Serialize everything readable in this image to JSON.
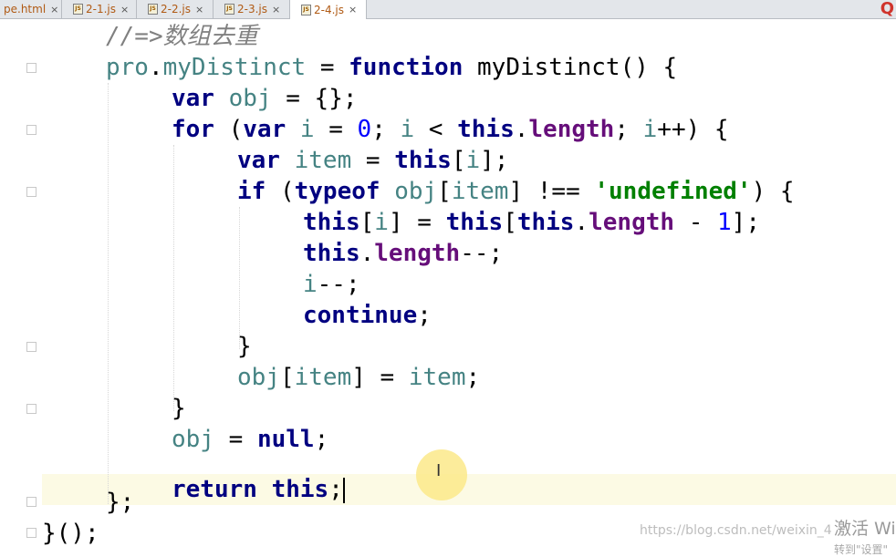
{
  "tabs": [
    {
      "label": "pe.html",
      "icon": "html-file-icon",
      "close": "×",
      "active": false
    },
    {
      "label": "2-1.js",
      "icon_text": "JS",
      "close": "×",
      "active": false
    },
    {
      "label": "2-2.js",
      "icon_text": "JS",
      "close": "×",
      "active": false
    },
    {
      "label": "2-3.js",
      "icon_text": "JS",
      "close": "×",
      "active": false
    },
    {
      "label": "2-4.js",
      "icon_text": "JS",
      "close": "×",
      "active": true
    }
  ],
  "tab_overflow_glyph": "Q",
  "code": {
    "l1": {
      "comment": "//=>数组去重"
    },
    "l2": {
      "a": "pro",
      "b": ".",
      "c": "myDistinct",
      "d": " = ",
      "e": "function",
      "f": " myDistinct",
      "g": "() {"
    },
    "l3": {
      "a": "var",
      "b": " obj",
      "c": " = {};"
    },
    "l4": {
      "a": "for",
      "b": " (",
      "c": "var",
      "d": " i",
      "e": " = ",
      "f": "0",
      "g": "; ",
      "h": "i",
      "i": " < ",
      "j": "this",
      "k": ".",
      "l": "length",
      "m": "; ",
      "n": "i",
      "o": "++) {"
    },
    "l5": {
      "a": "var",
      "b": " item",
      "c": " = ",
      "d": "this",
      "e": "[",
      "f": "i",
      "g": "];"
    },
    "l6": {
      "a": "if",
      "b": " (",
      "c": "typeof",
      "d": " obj",
      "e": "[",
      "f": "item",
      "g": "] !== ",
      "h": "'undefined'",
      "i": ") {"
    },
    "l7": {
      "a": "this",
      "b": "[",
      "c": "i",
      "d": "] = ",
      "e": "this",
      "f": "[",
      "g": "this",
      "h": ".",
      "i": "length",
      "j": " - ",
      "k": "1",
      "l": "];"
    },
    "l8": {
      "a": "this",
      "b": ".",
      "c": "length",
      "d": "--;"
    },
    "l9": {
      "a": "i",
      "b": "--;"
    },
    "l10": {
      "a": "continue",
      "b": ";"
    },
    "l11": {
      "a": "}"
    },
    "l12": {
      "a": "obj",
      "b": "[",
      "c": "item",
      "d": "] = ",
      "e": "item",
      "f": ";"
    },
    "l13": {
      "a": "}"
    },
    "l14": {
      "a": "obj",
      "b": " = ",
      "c": "null",
      "d": ";"
    },
    "l15": {
      "a": "return",
      "b": " ",
      "c": "this",
      "d": ";"
    },
    "l16": {
      "a": "};"
    },
    "l17": {
      "a": "}",
      "b": "();"
    }
  },
  "cursor_glyph": "I",
  "watermark": {
    "url": "https://blog.csdn.net/weixin_4",
    "activate": "激活 Wi",
    "activate_sub": "转到\"设置\""
  },
  "colors": {
    "keyword": "#000080",
    "variable": "#458383",
    "property": "#660e7a",
    "number": "#0000ff",
    "string": "#008000",
    "comment": "#808080",
    "caret_row": "#fcfae4"
  }
}
